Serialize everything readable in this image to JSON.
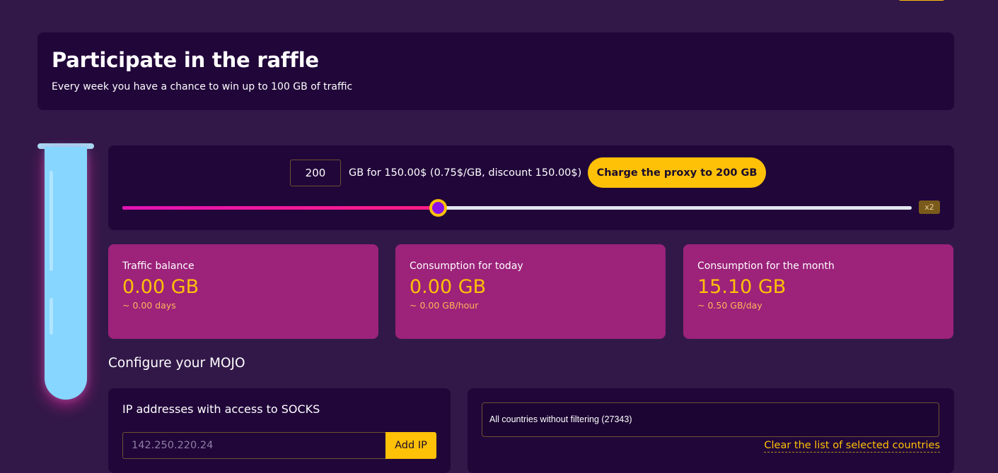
{
  "raffle": {
    "title": "Participate in the raffle",
    "subtitle": "Every week you have a chance to win up to 100 GB of traffic"
  },
  "purchase": {
    "gb_value": "200",
    "price_text": "GB for 150.00$ (0.75$/GB, discount 150.00$)",
    "charge_button": "Charge the proxy to 200 GB",
    "slider_fraction": 0.4,
    "multiplier_badge": "x2"
  },
  "stats": [
    {
      "label": "Traffic balance",
      "value": "0.00 GB",
      "sub": "~ 0.00 days"
    },
    {
      "label": "Consumption for today",
      "value": "0.00 GB",
      "sub": "~ 0.00 GB/hour"
    },
    {
      "label": "Consumption for the month",
      "value": "15.10 GB",
      "sub": "~ 0.50 GB/day"
    }
  ],
  "configure": {
    "title": "Configure your MOJO"
  },
  "ip_access": {
    "heading": "IP addresses with access to SOCKS",
    "placeholder": "142.250.220.24",
    "add_button": "Add IP"
  },
  "countries": {
    "selected_text": "All countries without filtering (27343)",
    "clear_link": "Clear the list of selected countries"
  },
  "colors": {
    "background": "#321849",
    "panel": "#21063a",
    "accent": "#ffc107",
    "card": "#9c227a",
    "slider_fill": "#ff1e83",
    "tube": "#86d6ff"
  }
}
